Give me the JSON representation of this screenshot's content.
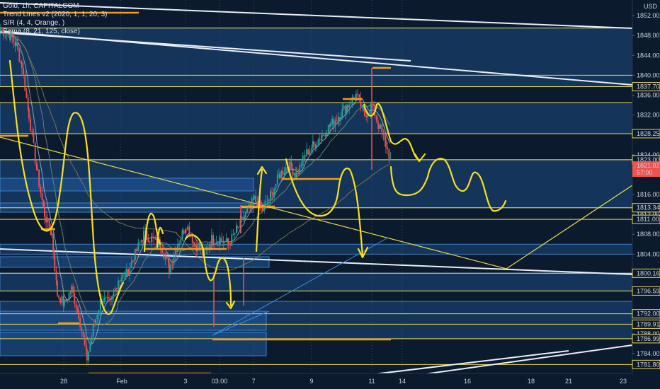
{
  "legend": {
    "symbol_line": "Gold, 1h, CAPITALCOM",
    "indicator_1": "Trend Lines v2 (2020, 1, 1, 20, 3)",
    "indicator_2": "S/R (4, 4, Orange, )",
    "indicator_3": "Sema (8, 21, 125, close)"
  },
  "currency_label": "USD",
  "colors": {
    "background": "#0c1a2e",
    "zone_fill": "#1b4a80",
    "zone_stroke": "#3f7fc4",
    "level_line": "#e8d84a",
    "sr_line": "#f39c12",
    "trend_line": "#e8eef6",
    "hand_drawing": "#f5e11a",
    "bull_candle": "#26a69a",
    "bear_candle": "#ef5350",
    "price_tag": "#ef5350"
  },
  "chart_data": {
    "type": "candlestick",
    "symbol": "Gold",
    "timeframe": "1h",
    "source": "CAPITALCOM",
    "ylim": [
      1780,
      1854
    ],
    "y_ticks": [
      {
        "value": 1852,
        "label": "1852.00"
      },
      {
        "value": 1848,
        "label": "1848.00"
      },
      {
        "value": 1844,
        "label": "1844.00"
      },
      {
        "value": 1840,
        "label": "1840.00"
      },
      {
        "value": 1836,
        "label": "1836.00"
      },
      {
        "value": 1832,
        "label": "1832.00"
      },
      {
        "value": 1824,
        "label": "1824.00"
      },
      {
        "value": 1816,
        "label": "1816.00"
      },
      {
        "value": 1812,
        "label": "1812.00"
      },
      {
        "value": 1808,
        "label": "1808.00"
      },
      {
        "value": 1804,
        "label": "1804.00"
      },
      {
        "value": 1788,
        "label": "1788.00"
      },
      {
        "value": 1784,
        "label": "1784.00"
      }
    ],
    "x_ticks": [
      "28",
      "Feb",
      "3",
      "03:00",
      "7",
      "9",
      "11",
      "14",
      "16",
      "18",
      "21",
      "23"
    ],
    "level_labels": [
      {
        "value": 1837.7,
        "label": "1837.70"
      },
      {
        "value": 1828.25,
        "label": "1828.25"
      },
      {
        "value": 1823.0,
        "label": "1823.00"
      },
      {
        "value": 1813.34,
        "label": "1813.34"
      },
      {
        "value": 1811.0,
        "label": "1811.00"
      },
      {
        "value": 1800.16,
        "label": "1800.16"
      },
      {
        "value": 1796.59,
        "label": "1796.59"
      },
      {
        "value": 1792.0,
        "label": "1792.00"
      },
      {
        "value": 1789.91,
        "label": "1789.91"
      },
      {
        "value": 1786.99,
        "label": "1786.99"
      },
      {
        "value": 1781.8,
        "label": "1781.80"
      }
    ],
    "current_price": {
      "value": 1821.82,
      "label": "1821.82",
      "countdown": "57:00"
    },
    "zones": [
      [
        1837.7,
        1849.5
      ],
      [
        1828.25,
        1834.5
      ],
      [
        1813.34,
        1823.0
      ],
      [
        1804.0,
        1806.0
      ],
      [
        1796.6,
        1800.2
      ],
      [
        1786.99,
        1794.5
      ]
    ],
    "key_levels": [
      1849.5,
      1840.0,
      1837.7,
      1834.5,
      1828.25,
      1823.0,
      1813.34,
      1811.0,
      1800.16,
      1796.59,
      1792.0,
      1789.91,
      1786.99,
      1781.8
    ],
    "price_path": [
      [
        0,
        1849
      ],
      [
        14,
        1848
      ],
      [
        22,
        1846
      ],
      [
        30,
        1842
      ],
      [
        40,
        1832
      ],
      [
        52,
        1820
      ],
      [
        62,
        1812
      ],
      [
        72,
        1808
      ],
      [
        80,
        1796
      ],
      [
        90,
        1794
      ],
      [
        100,
        1797
      ],
      [
        110,
        1792
      ],
      [
        122,
        1783
      ],
      [
        132,
        1790
      ],
      [
        142,
        1795
      ],
      [
        155,
        1794
      ],
      [
        166,
        1799
      ],
      [
        178,
        1800
      ],
      [
        190,
        1804
      ],
      [
        202,
        1808
      ],
      [
        214,
        1807
      ],
      [
        226,
        1806
      ],
      [
        238,
        1801
      ],
      [
        250,
        1806
      ],
      [
        262,
        1810
      ],
      [
        274,
        1806
      ],
      [
        286,
        1804
      ],
      [
        298,
        1807
      ],
      [
        310,
        1807
      ],
      [
        322,
        1806
      ],
      [
        334,
        1809
      ],
      [
        346,
        1812
      ],
      [
        358,
        1815
      ],
      [
        370,
        1813
      ],
      [
        382,
        1816
      ],
      [
        394,
        1820
      ],
      [
        406,
        1822
      ],
      [
        418,
        1820
      ],
      [
        430,
        1824
      ],
      [
        442,
        1826
      ],
      [
        454,
        1828
      ],
      [
        466,
        1830
      ],
      [
        478,
        1832
      ],
      [
        490,
        1834
      ],
      [
        502,
        1836
      ],
      [
        514,
        1832
      ],
      [
        524,
        1834
      ],
      [
        534,
        1830
      ],
      [
        544,
        1826
      ],
      [
        552,
        1822
      ]
    ]
  }
}
